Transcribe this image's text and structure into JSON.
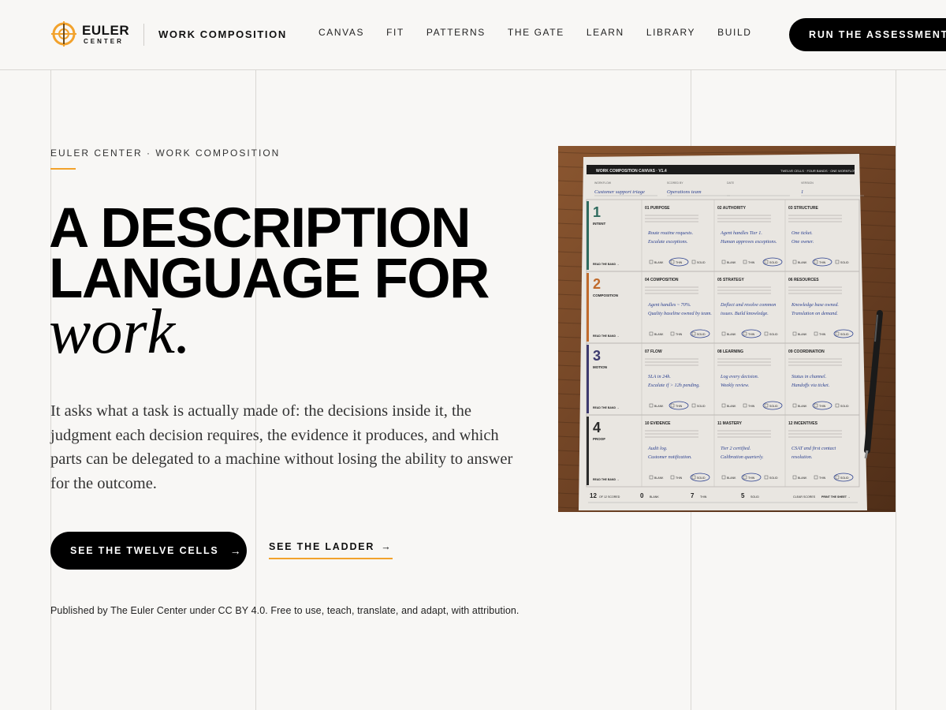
{
  "brand": {
    "name_line1": "EULER",
    "name_line2": "CENTER",
    "section": "WORK COMPOSITION",
    "accent": "#f2a22c",
    "logo_icon": "crosshair-circle-icon"
  },
  "nav": {
    "items": [
      "CANVAS",
      "FIT",
      "PATTERNS",
      "THE GATE",
      "LEARN",
      "LIBRARY",
      "BUILD"
    ],
    "cta": "RUN THE ASSESSMENT"
  },
  "hero": {
    "eyebrow": "EULER CENTER · WORK COMPOSITION",
    "title_line1": "A DESCRIPTION",
    "title_line2": "LANGUAGE FOR",
    "title_line3": "work.",
    "lede": "It asks what a task is actually made of: the decisions inside it, the judgment each decision requires, the evidence it produces, and which parts can be delegated to a machine without losing the ability to answer for the outcome.",
    "primary_button": "SEE THE TWELVE CELLS",
    "secondary_link": "SEE THE LADDER",
    "arrow": "→",
    "license": "Published by The Euler Center under CC BY 4.0. Free to use, teach, translate, and adapt, with attribution."
  },
  "sheet": {
    "title": "WORK COMPOSITION CANVAS · V1.4",
    "subtitle": "TWELVE CELLS · FOUR BANDS · ONE WORKFLOW",
    "fields": [
      {
        "label": "WORKFLOW",
        "value": "Customer support triage"
      },
      {
        "label": "SCORED BY",
        "value": "Operations team"
      },
      {
        "label": "DATE",
        "value": ""
      },
      {
        "label": "VERSION",
        "value": "1"
      }
    ],
    "bands": [
      {
        "num": "1",
        "name": "INTENT",
        "color": "#2f6b5e",
        "cells": [
          {
            "num": "01",
            "name": "PURPOSE",
            "hand": [
              "Route routine requests.",
              "Escalate exceptions."
            ]
          },
          {
            "num": "02",
            "name": "AUTHORITY",
            "hand": [
              "Agent handles Tier 1.",
              "Human approves exceptions."
            ]
          },
          {
            "num": "03",
            "name": "STRUCTURE",
            "hand": [
              "One ticket.",
              "One owner."
            ]
          }
        ]
      },
      {
        "num": "2",
        "name": "COMPOSITION",
        "color": "#c06a2b",
        "cells": [
          {
            "num": "04",
            "name": "COMPOSITION",
            "hand": [
              "Agent handles ~ 70%.",
              "Quality baseline owned by team."
            ]
          },
          {
            "num": "05",
            "name": "STRATEGY",
            "hand": [
              "Deflect and resolve common",
              "issues. Build knowledge."
            ]
          },
          {
            "num": "06",
            "name": "RESOURCES",
            "hand": [
              "Knowledge base owned.",
              "Translation on demand."
            ]
          }
        ]
      },
      {
        "num": "3",
        "name": "MOTION",
        "color": "#3d3a6e",
        "cells": [
          {
            "num": "07",
            "name": "FLOW",
            "hand": [
              "SLA in 24h.",
              "Escalate if > 12h pending."
            ]
          },
          {
            "num": "08",
            "name": "LEARNING",
            "hand": [
              "Log every decision.",
              "Weekly review."
            ]
          },
          {
            "num": "09",
            "name": "COORDINATION",
            "hand": [
              "Status in channel.",
              "Handoffs via ticket."
            ]
          }
        ]
      },
      {
        "num": "4",
        "name": "PROOF",
        "color": "#2b2b2b",
        "cells": [
          {
            "num": "10",
            "name": "EVIDENCE",
            "hand": [
              "Audit log.",
              "Customer notification."
            ]
          },
          {
            "num": "11",
            "name": "MASTERY",
            "hand": [
              "Tier 2 certified.",
              "Calibration quarterly."
            ]
          },
          {
            "num": "12",
            "name": "INCENTIVES",
            "hand": [
              "CSAT and first contact",
              "resolution."
            ]
          }
        ]
      }
    ],
    "band_link": "READ THE BAND",
    "levels": [
      "BLANK",
      "THIN",
      "SOLID"
    ],
    "footer_scores": [
      {
        "value": "12",
        "label": "OF 12 SCORED"
      },
      {
        "value": "0",
        "label": "BLANK"
      },
      {
        "value": "7",
        "label": "THIN"
      },
      {
        "value": "5",
        "label": "SOLID"
      }
    ],
    "footer_actions": [
      "CLEAR SCORES",
      "PRINT THE SHEET"
    ]
  }
}
